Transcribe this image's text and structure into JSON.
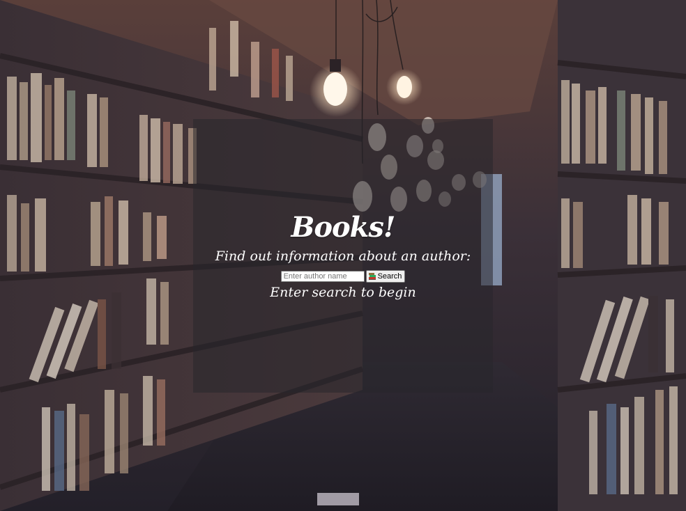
{
  "header": {
    "title": "Books!",
    "subtitle": "Find out information about an author:"
  },
  "search": {
    "placeholder": "Enter author name",
    "value": "",
    "button_label": "Search",
    "button_icon": "books-icon"
  },
  "status": {
    "message": "Enter search to begin"
  },
  "background": {
    "subject": "library-bookshelves-photo",
    "overlay_color": "#28262c"
  }
}
